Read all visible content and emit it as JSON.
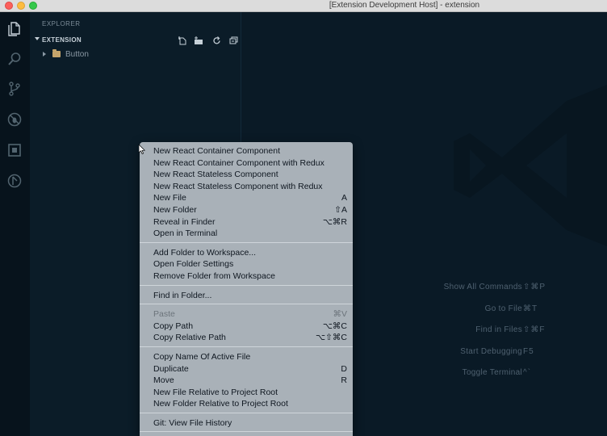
{
  "window": {
    "title": "[Extension Development Host] - extension"
  },
  "activity_bar": {
    "icons": [
      "files-icon",
      "search-icon",
      "source-control-icon",
      "debug-icon",
      "extensions-icon",
      "history-icon"
    ]
  },
  "sidebar": {
    "title": "EXPLORER",
    "section": "EXTENSION",
    "tools": [
      "new-file-icon",
      "new-folder-icon",
      "refresh-icon",
      "collapse-all-icon"
    ],
    "tree": [
      {
        "label": "Button",
        "type": "folder"
      }
    ]
  },
  "editor": {
    "shortcuts": [
      {
        "label": "Show All Commands",
        "keys": "⇧⌘P"
      },
      {
        "label": "Go to File",
        "keys": "⌘T"
      },
      {
        "label": "Find in Files",
        "keys": "⇧⌘F"
      },
      {
        "label": "Start Debugging",
        "keys": "F5"
      },
      {
        "label": "Toggle Terminal",
        "keys": "^`"
      }
    ]
  },
  "context_menu": {
    "groups": [
      [
        {
          "label": "New React Container Component",
          "key": ""
        },
        {
          "label": "New React Container Component with Redux",
          "key": ""
        },
        {
          "label": "New React Stateless Component",
          "key": ""
        },
        {
          "label": "New React Stateless Component with Redux",
          "key": ""
        },
        {
          "label": "New File",
          "key": "A"
        },
        {
          "label": "New Folder",
          "key": "⇧A"
        },
        {
          "label": "Reveal in Finder",
          "key": "⌥⌘R"
        },
        {
          "label": "Open in Terminal",
          "key": ""
        }
      ],
      [
        {
          "label": "Add Folder to Workspace...",
          "key": ""
        },
        {
          "label": "Open Folder Settings",
          "key": ""
        },
        {
          "label": "Remove Folder from Workspace",
          "key": ""
        }
      ],
      [
        {
          "label": "Find in Folder...",
          "key": ""
        }
      ],
      [
        {
          "label": "Paste",
          "key": "⌘V",
          "disabled": true
        },
        {
          "label": "Copy Path",
          "key": "⌥⌘C"
        },
        {
          "label": "Copy Relative Path",
          "key": "⌥⇧⌘C"
        }
      ],
      [
        {
          "label": "Copy Name Of Active File",
          "key": ""
        },
        {
          "label": "Duplicate",
          "key": "D"
        },
        {
          "label": "Move",
          "key": "R"
        },
        {
          "label": "New File Relative to Project Root",
          "key": ""
        },
        {
          "label": "New Folder Relative to Project Root",
          "key": ""
        }
      ],
      [
        {
          "label": "Git: View File History",
          "key": ""
        }
      ]
    ]
  }
}
